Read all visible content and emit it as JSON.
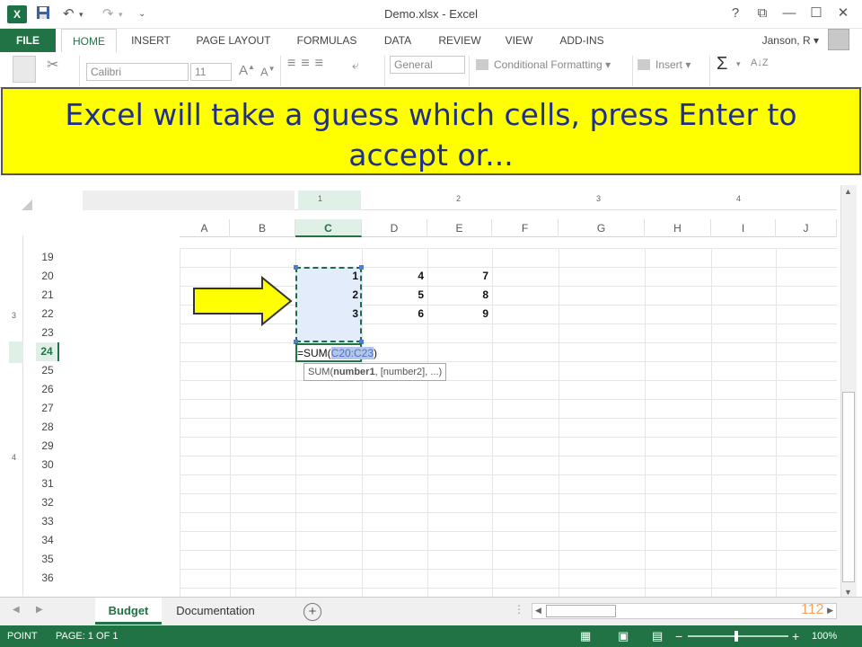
{
  "window": {
    "title": "Demo.xlsx - Excel",
    "app_icon_text": "X",
    "help_icon": "?",
    "restore_ribbon_icon": "⧉",
    "minimize_icon": "—",
    "maximize_icon": "☐",
    "close_icon": "✕"
  },
  "qat": {
    "save_icon": "💾",
    "undo_icon": "↶",
    "redo_icon": "↷",
    "customize_icon": "⌄"
  },
  "ribbon": {
    "tabs": [
      "FILE",
      "HOME",
      "INSERT",
      "PAGE LAYOUT",
      "FORMULAS",
      "DATA",
      "REVIEW",
      "VIEW",
      "ADD-INS"
    ],
    "active_tab": "HOME",
    "user_name": "Janson, R",
    "font_name": "Calibri",
    "font_size": "11",
    "number_format": "General",
    "conditional_formatting": "Conditional Formatting",
    "insert_label": "Insert",
    "sum_icon": "Σ",
    "sort_icon": "A↓Z"
  },
  "callout": {
    "text": "Excel will take a guess which cells, press Enter to accept or..."
  },
  "ruler": {
    "top_marks": [
      "1",
      "2",
      "3",
      "4"
    ],
    "left_marks": [
      "3",
      "4"
    ]
  },
  "sheet": {
    "columns": [
      "A",
      "B",
      "C",
      "D",
      "E",
      "F",
      "G",
      "H",
      "I",
      "J"
    ],
    "selected_column": "C",
    "rows": [
      "19",
      "20",
      "21",
      "22",
      "23",
      "24",
      "25",
      "26",
      "27",
      "28",
      "29",
      "30",
      "31",
      "32",
      "33",
      "34",
      "35",
      "36"
    ],
    "selected_row": "24",
    "cells": {
      "C20": "1",
      "D20": "4",
      "E20": "7",
      "C21": "2",
      "D21": "5",
      "E21": "8",
      "C22": "3",
      "D22": "6",
      "E22": "9"
    },
    "formula_prefix": "=SUM(",
    "formula_ref": "C20:C23",
    "formula_suffix": ")",
    "tooltip_prefix": "SUM(",
    "tooltip_bold": "number1",
    "tooltip_rest": ", [number2], ...)"
  },
  "sheet_tabs": {
    "tabs": [
      "Budget",
      "Documentation"
    ],
    "active": "Budget",
    "add_icon": "+"
  },
  "slide_number": "112",
  "statusbar": {
    "mode": "POINT",
    "page": "PAGE: 1 OF 1",
    "zoom": "100%",
    "zoom_minus": "−",
    "zoom_plus": "+"
  },
  "colors": {
    "excel_green": "#217346",
    "callout_yellow": "#ffff00",
    "callout_text": "#1f2f8c",
    "selection_fill": "#e3ecfa",
    "arrow_fill": "#ffff00"
  }
}
